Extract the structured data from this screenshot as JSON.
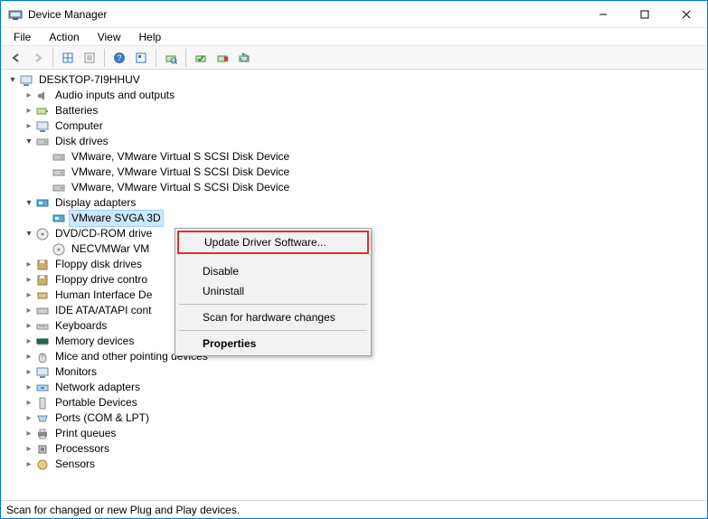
{
  "window": {
    "title": "Device Manager"
  },
  "menu": {
    "file": "File",
    "action": "Action",
    "view": "View",
    "help": "Help"
  },
  "root": "DESKTOP-7I9HHUV",
  "categories": {
    "audio": {
      "label": "Audio inputs and outputs",
      "expanded": false
    },
    "batt": {
      "label": "Batteries",
      "expanded": false
    },
    "comp": {
      "label": "Computer",
      "expanded": false
    },
    "disk": {
      "label": "Disk drives",
      "expanded": true,
      "children": [
        "VMware, VMware Virtual S SCSI Disk Device",
        "VMware, VMware Virtual S SCSI Disk Device",
        "VMware, VMware Virtual S SCSI Disk Device"
      ]
    },
    "display": {
      "label": "Display adapters",
      "expanded": true,
      "children": [
        "VMware SVGA 3D"
      ]
    },
    "dvd": {
      "label": "DVD/CD-ROM drive",
      "expanded": true,
      "truncated": true,
      "children": [
        "NECVMWar VM"
      ]
    },
    "floppy_disk": {
      "label": "Floppy disk drives",
      "expanded": false
    },
    "floppy_ctl": {
      "label": "Floppy drive contro",
      "expanded": false,
      "truncated": true
    },
    "hid": {
      "label": "Human Interface De",
      "expanded": false,
      "truncated": true
    },
    "ide": {
      "label": "IDE ATA/ATAPI cont",
      "expanded": false,
      "truncated": true
    },
    "keyb": {
      "label": "Keyboards",
      "expanded": false
    },
    "mem": {
      "label": "Memory devices",
      "expanded": false
    },
    "mice": {
      "label": "Mice and other pointing devices",
      "expanded": false
    },
    "mon": {
      "label": "Monitors",
      "expanded": false
    },
    "net": {
      "label": "Network adapters",
      "expanded": false
    },
    "port_dev": {
      "label": "Portable Devices",
      "expanded": false
    },
    "ports": {
      "label": "Ports (COM & LPT)",
      "expanded": false
    },
    "printq": {
      "label": "Print queues",
      "expanded": false
    },
    "proc": {
      "label": "Processors",
      "expanded": false
    },
    "sens": {
      "label": "Sensors",
      "expanded": false
    }
  },
  "selected_device": "VMware SVGA 3D",
  "context_menu": {
    "update": "Update Driver Software...",
    "disable": "Disable",
    "uninstall": "Uninstall",
    "scan": "Scan for hardware changes",
    "props": "Properties"
  },
  "status": "Scan for changed or new Plug and Play devices."
}
